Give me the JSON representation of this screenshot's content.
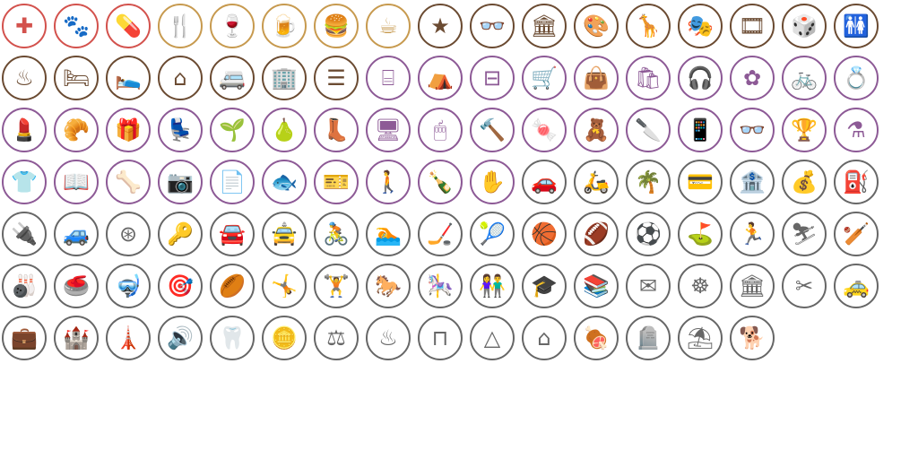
{
  "palette": {
    "red": "#d3524d",
    "gold": "#c79a4f",
    "brown": "#6b4b32",
    "purple": "#8d5a96",
    "gray": "#676767"
  },
  "rows": [
    {
      "color": "red",
      "icons": [
        {
          "name": "medical-cross-icon",
          "glyph": "✚"
        },
        {
          "name": "paw-print-icon",
          "glyph": "🐾"
        },
        {
          "name": "pill-capsule-icon",
          "glyph": "💊"
        }
      ]
    },
    {
      "color": "gold",
      "icons": [
        {
          "name": "fork-knife-icon",
          "glyph": "🍴"
        },
        {
          "name": "wine-glass-icon",
          "glyph": "🍷"
        },
        {
          "name": "beer-mug-icon",
          "glyph": "🍺"
        },
        {
          "name": "hamburger-icon",
          "glyph": "🍔"
        },
        {
          "name": "coffee-cup-icon",
          "glyph": "☕"
        }
      ]
    },
    {
      "color": "brown",
      "icons": [
        {
          "name": "star-icon",
          "glyph": "★"
        },
        {
          "name": "binoculars-icon",
          "glyph": "👓"
        },
        {
          "name": "museum-icon",
          "glyph": "🏛"
        },
        {
          "name": "art-palette-icon",
          "glyph": "🎨"
        },
        {
          "name": "giraffe-icon",
          "glyph": "🦒"
        },
        {
          "name": "theater-masks-icon",
          "glyph": "🎭"
        },
        {
          "name": "cinema-film-icon",
          "glyph": "🎞"
        },
        {
          "name": "dice-icon",
          "glyph": "🎲"
        },
        {
          "name": "restroom-icon",
          "glyph": "🚻"
        }
      ]
    }
  ],
  "row2": [
    {
      "color": "brown",
      "name": "hot-tub-icon",
      "glyph": "♨"
    },
    {
      "color": "brown",
      "name": "hostel-bed-icon",
      "glyph": "🛏"
    },
    {
      "color": "brown",
      "name": "hotel-bed-icon",
      "glyph": "🛌"
    },
    {
      "color": "brown",
      "name": "house-icon",
      "glyph": "⌂"
    },
    {
      "color": "brown",
      "name": "camper-trailer-icon",
      "glyph": "🚐"
    },
    {
      "color": "brown",
      "name": "apartment-building-icon",
      "glyph": "🏢"
    },
    {
      "color": "brown",
      "name": "bunk-bed-icon",
      "glyph": "☰"
    },
    {
      "color": "purple",
      "name": "storefront-icon",
      "glyph": "⌸"
    },
    {
      "color": "purple",
      "name": "market-stall-icon",
      "glyph": "⛺"
    },
    {
      "color": "purple",
      "name": "kiosk-icon",
      "glyph": "⊟"
    },
    {
      "color": "purple",
      "name": "shopping-cart-icon",
      "glyph": "🛒"
    },
    {
      "color": "purple",
      "name": "shopping-bag-icon",
      "glyph": "👜"
    },
    {
      "color": "purple",
      "name": "gift-bag-icon",
      "glyph": "🛍"
    },
    {
      "color": "purple",
      "name": "headphones-icon",
      "glyph": "🎧"
    },
    {
      "color": "purple",
      "name": "flower-icon",
      "glyph": "✿"
    },
    {
      "color": "purple",
      "name": "bicycle-icon",
      "glyph": "🚲"
    },
    {
      "color": "purple",
      "name": "ring-icon",
      "glyph": "💍"
    }
  ],
  "row3": [
    {
      "name": "cosmetics-icon",
      "glyph": "💄"
    },
    {
      "name": "bakery-croissant-icon",
      "glyph": "🥐"
    },
    {
      "name": "gift-box-icon",
      "glyph": "🎁"
    },
    {
      "name": "armchair-icon",
      "glyph": "💺"
    },
    {
      "name": "potted-plant-icon",
      "glyph": "🌱"
    },
    {
      "name": "pear-icon",
      "glyph": "🍐"
    },
    {
      "name": "boot-icon",
      "glyph": "👢"
    },
    {
      "name": "computer-monitor-icon",
      "glyph": "🖥"
    },
    {
      "name": "computer-mouse-icon",
      "glyph": "🖱"
    },
    {
      "name": "hardware-hammer-icon",
      "glyph": "🔨"
    },
    {
      "name": "candy-icon",
      "glyph": "🍬"
    },
    {
      "name": "toy-teddy-icon",
      "glyph": "🧸"
    },
    {
      "name": "butcher-cleaver-icon",
      "glyph": "🔪"
    },
    {
      "name": "mobile-phone-icon",
      "glyph": "📱"
    },
    {
      "name": "eyeglasses-icon",
      "glyph": "👓"
    },
    {
      "name": "trophy-icon",
      "glyph": "🏆"
    },
    {
      "name": "mortar-pestle-icon",
      "glyph": "⚗"
    }
  ],
  "row4": [
    {
      "color": "purple",
      "name": "tshirt-icon",
      "glyph": "👕"
    },
    {
      "color": "purple",
      "name": "open-book-icon",
      "glyph": "📖"
    },
    {
      "color": "purple",
      "name": "bone-icon",
      "glyph": "🦴"
    },
    {
      "color": "purple",
      "name": "camera-icon",
      "glyph": "📷"
    },
    {
      "color": "purple",
      "name": "copy-shop-icon",
      "glyph": "📄"
    },
    {
      "color": "purple",
      "name": "fish-icon",
      "glyph": "🐟"
    },
    {
      "color": "purple",
      "name": "ticket-icon",
      "glyph": "🎫"
    },
    {
      "color": "purple",
      "name": "hiker-icon",
      "glyph": "🚶"
    },
    {
      "color": "purple",
      "name": "wine-bottle-icon",
      "glyph": "🍾"
    },
    {
      "color": "purple",
      "name": "hand-icon",
      "glyph": "✋"
    },
    {
      "color": "gray",
      "name": "car-icon",
      "glyph": "🚗"
    },
    {
      "color": "gray",
      "name": "scooter-icon",
      "glyph": "🛵"
    },
    {
      "color": "gray",
      "name": "palm-beach-icon",
      "glyph": "🌴"
    },
    {
      "color": "gray",
      "name": "credit-card-icon",
      "glyph": "💳"
    },
    {
      "color": "gray",
      "name": "bank-icon",
      "glyph": "🏦"
    },
    {
      "color": "gray",
      "name": "money-hand-icon",
      "glyph": "💰"
    },
    {
      "color": "gray",
      "name": "fuel-pump-icon",
      "glyph": "⛽"
    }
  ],
  "row5": [
    {
      "name": "ev-charging-icon",
      "glyph": "🔌"
    },
    {
      "name": "car-lift-icon",
      "glyph": "🚙"
    },
    {
      "name": "tire-icon",
      "glyph": "⊛"
    },
    {
      "name": "car-key-icon",
      "glyph": "🔑"
    },
    {
      "name": "car-rental-icon",
      "glyph": "🚘"
    },
    {
      "name": "car-wash-icon",
      "glyph": "🚖"
    },
    {
      "name": "cycling-icon",
      "glyph": "🚴"
    },
    {
      "name": "swimming-icon",
      "glyph": "🏊"
    },
    {
      "name": "hockey-stick-icon",
      "glyph": "🏒"
    },
    {
      "name": "tennis-racket-icon",
      "glyph": "🎾"
    },
    {
      "name": "basketball-hoop-icon",
      "glyph": "🏀"
    },
    {
      "name": "american-football-icon",
      "glyph": "🏈"
    },
    {
      "name": "soccer-ball-icon",
      "glyph": "⚽"
    },
    {
      "name": "golf-flag-icon",
      "glyph": "⛳"
    },
    {
      "name": "athlete-running-icon",
      "glyph": "🏃"
    },
    {
      "name": "skiing-icon",
      "glyph": "⛷"
    },
    {
      "name": "cricket-bat-icon",
      "glyph": "🏏"
    }
  ],
  "row6": [
    {
      "name": "bowling-icon",
      "glyph": "🎳"
    },
    {
      "name": "curling-stone-icon",
      "glyph": "🥌"
    },
    {
      "name": "diving-icon",
      "glyph": "🤿"
    },
    {
      "name": "archery-target-icon",
      "glyph": "🎯"
    },
    {
      "name": "rugby-ball-icon",
      "glyph": "🏉"
    },
    {
      "name": "gymnastics-icon",
      "glyph": "🤸"
    },
    {
      "name": "dumbbell-icon",
      "glyph": "🏋"
    },
    {
      "name": "horse-riding-icon",
      "glyph": "🐎"
    },
    {
      "name": "rocking-horse-icon",
      "glyph": "🎠"
    },
    {
      "name": "children-playing-icon",
      "glyph": "👫"
    },
    {
      "name": "graduation-cap-icon",
      "glyph": "🎓"
    },
    {
      "name": "library-book-icon",
      "glyph": "📚"
    },
    {
      "name": "envelope-icon",
      "glyph": "✉"
    },
    {
      "name": "ship-wheel-icon",
      "glyph": "☸"
    },
    {
      "name": "town-hall-icon",
      "glyph": "🏛"
    },
    {
      "name": "scissors-icon",
      "glyph": "✂"
    },
    {
      "name": "taxi-icon",
      "glyph": "🚕"
    }
  ],
  "row7": [
    {
      "name": "suitcase-icon",
      "glyph": "💼"
    },
    {
      "name": "castle-tower-icon",
      "glyph": "🏰"
    },
    {
      "name": "lighthouse-icon",
      "glyph": "🗼"
    },
    {
      "name": "speaker-icon",
      "glyph": "🔊"
    },
    {
      "name": "tooth-icon",
      "glyph": "🦷"
    },
    {
      "name": "coins-icon",
      "glyph": "🪙"
    },
    {
      "name": "auction-gavel-icon",
      "glyph": "⚖"
    },
    {
      "name": "sauna-icon",
      "glyph": "♨"
    },
    {
      "name": "picnic-table-icon",
      "glyph": "⊓"
    },
    {
      "name": "tent-icon",
      "glyph": "△"
    },
    {
      "name": "shelter-icon",
      "glyph": "⌂"
    },
    {
      "name": "bbq-grill-icon",
      "glyph": "🍖"
    },
    {
      "name": "gravestone-icon",
      "glyph": "🪦"
    },
    {
      "name": "beach-umbrella-icon",
      "glyph": "⛱"
    },
    {
      "name": "dog-park-icon",
      "glyph": "🐕"
    }
  ]
}
